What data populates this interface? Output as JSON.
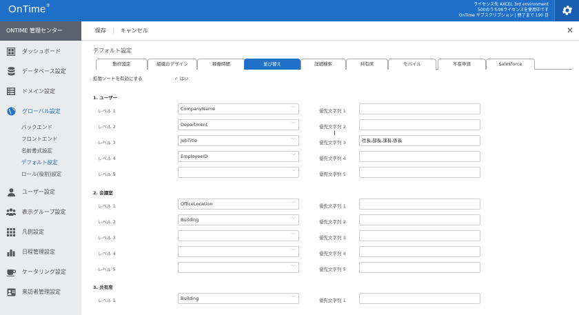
{
  "header": {
    "logo": "OnTime",
    "logo_mark": "®",
    "license_lines": [
      "ライセンス先 AXCEL 3rd environment",
      "500のうち98ライセンスを使用中です",
      "OnTime サブスクリプション | 終了まで 190 日"
    ]
  },
  "sidebar": {
    "title": "ONTIME 管理センター",
    "items": [
      {
        "label": "ダッシュボード",
        "icon": "dashboard-icon"
      },
      {
        "label": "データベース設定",
        "icon": "database-icon"
      },
      {
        "label": "ドメイン設定",
        "icon": "domain-icon"
      },
      {
        "label": "グローバル設定",
        "icon": "globe-icon",
        "active": true
      },
      {
        "label": "ユーザー設定",
        "icon": "user-icon"
      },
      {
        "label": "表示グループ設定",
        "icon": "group-icon"
      },
      {
        "label": "凡例設定",
        "icon": "legend-icon"
      },
      {
        "label": "日程管理設定",
        "icon": "chart-icon"
      },
      {
        "label": "ケータリング設定",
        "icon": "coffee-icon"
      },
      {
        "label": "来訪者管理設定",
        "icon": "visitor-icon"
      }
    ],
    "subitems": [
      {
        "label": "バックエンド"
      },
      {
        "label": "フロントエンド"
      },
      {
        "label": "名前書式設定"
      },
      {
        "label": "デフォルト設定",
        "active": true
      },
      {
        "label": "ロール(役割)設定"
      }
    ]
  },
  "toolbar": {
    "save": "保存",
    "sep": "|",
    "cancel": "キャンセル",
    "close": "✕"
  },
  "page_title": "デフォルト設定",
  "tabs": [
    "動作設定",
    "組織のデザイン",
    "稼働時間",
    "並び替え",
    "詳細検索",
    "共有席",
    "モバイル",
    "不在申請",
    "Salesforce"
  ],
  "active_tab": "並び替え",
  "ext_sort": {
    "label": "拡張ソートを有効にする",
    "checkbox": "✓",
    "value": "はい"
  },
  "sections": [
    {
      "title": "1. ユーザー",
      "rows": [
        {
          "level": "レベル 1",
          "value": "CompanyName",
          "prio_label": "優先文字列 1",
          "prio": ""
        },
        {
          "level": "レベル 2",
          "value": "Department",
          "prio_label": "優先文字列 2",
          "prio": ""
        },
        {
          "level": "レベル 3",
          "value": "JobTitle",
          "prio_label": "優先文字列 3",
          "prio": "社長,部長,課長,係長"
        },
        {
          "level": "レベル 4",
          "value": "EmployeeID",
          "prio_label": "優先文字列 4",
          "prio": ""
        },
        {
          "level": "レベル 5",
          "value": "",
          "prio_label": "優先文字列 5",
          "prio": ""
        }
      ]
    },
    {
      "title": "2. 会議室",
      "rows": [
        {
          "level": "レベル 1",
          "value": "OfficeLocation",
          "prio_label": "優先文字列 1",
          "prio": ""
        },
        {
          "level": "レベル 2",
          "value": "Building",
          "prio_label": "優先文字列 2",
          "prio": ""
        },
        {
          "level": "レベル 3",
          "value": "",
          "prio_label": "優先文字列 3",
          "prio": ""
        },
        {
          "level": "レベル 4",
          "value": "",
          "prio_label": "優先文字列 4",
          "prio": ""
        },
        {
          "level": "レベル 5",
          "value": "",
          "prio_label": "優先文字列 5",
          "prio": ""
        }
      ]
    },
    {
      "title": "3. 共有席",
      "rows": [
        {
          "level": "レベル 1",
          "value": "Building",
          "prio_label": "優先文字列 1",
          "prio": ""
        }
      ]
    }
  ],
  "colors": {
    "header": "#1f6ec7",
    "accent": "#2170c9",
    "sidebar_title": "#5c6370"
  }
}
